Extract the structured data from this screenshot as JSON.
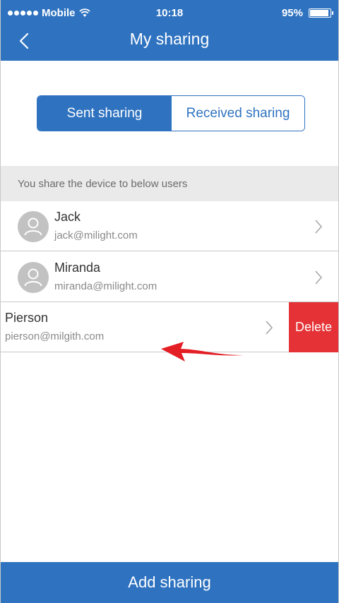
{
  "status_bar": {
    "carrier": "Mobile",
    "time": "10:18",
    "battery": "95%",
    "battery_level": 0.95
  },
  "nav": {
    "title": "My sharing",
    "back_icon": "chevron-left-icon"
  },
  "segments": {
    "sent": "Sent sharing",
    "received": "Received sharing",
    "selected": "sent"
  },
  "section_header": "You share the device to below users",
  "users": [
    {
      "name": "Jack",
      "email": "jack@milight.com"
    },
    {
      "name": "Miranda",
      "email": "miranda@milight.com"
    },
    {
      "name": "Pierson",
      "email": "pierson@milgith.com"
    }
  ],
  "delete_label": "Delete",
  "add_label": "Add sharing",
  "colors": {
    "primary": "#2f73c0",
    "delete": "#e53236",
    "arrow": "#e31e24"
  }
}
